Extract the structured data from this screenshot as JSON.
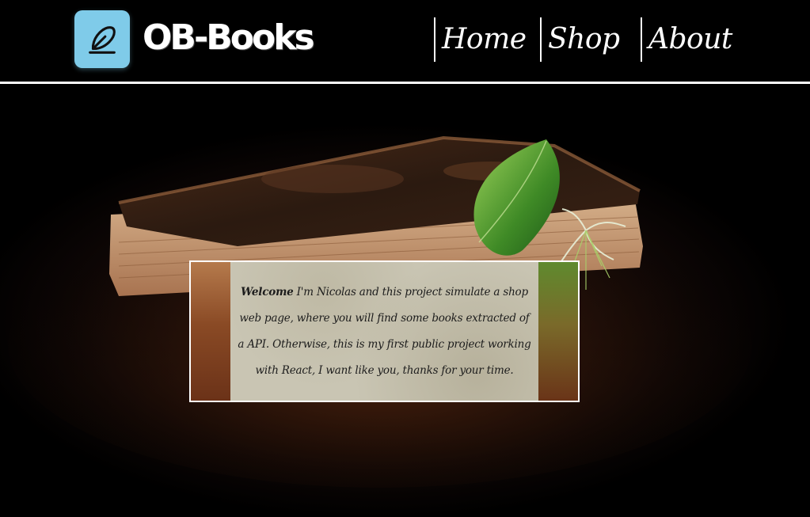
{
  "header": {
    "brand": "OB-Books",
    "logo_icon": "feather-pen-icon",
    "logo_color": "#7fcbe9",
    "nav": [
      {
        "label": "Home"
      },
      {
        "label": "Shop"
      },
      {
        "label": "About"
      }
    ]
  },
  "hero": {
    "image": "old-book-with-leaf-image"
  },
  "welcome": {
    "heading": "Welcome",
    "body": " I'm Nicolas and this project simulate a shop web page, where you will find some books extracted of a API. Otherwise, this is my first public project working with React, I want like you, thanks for your time."
  }
}
